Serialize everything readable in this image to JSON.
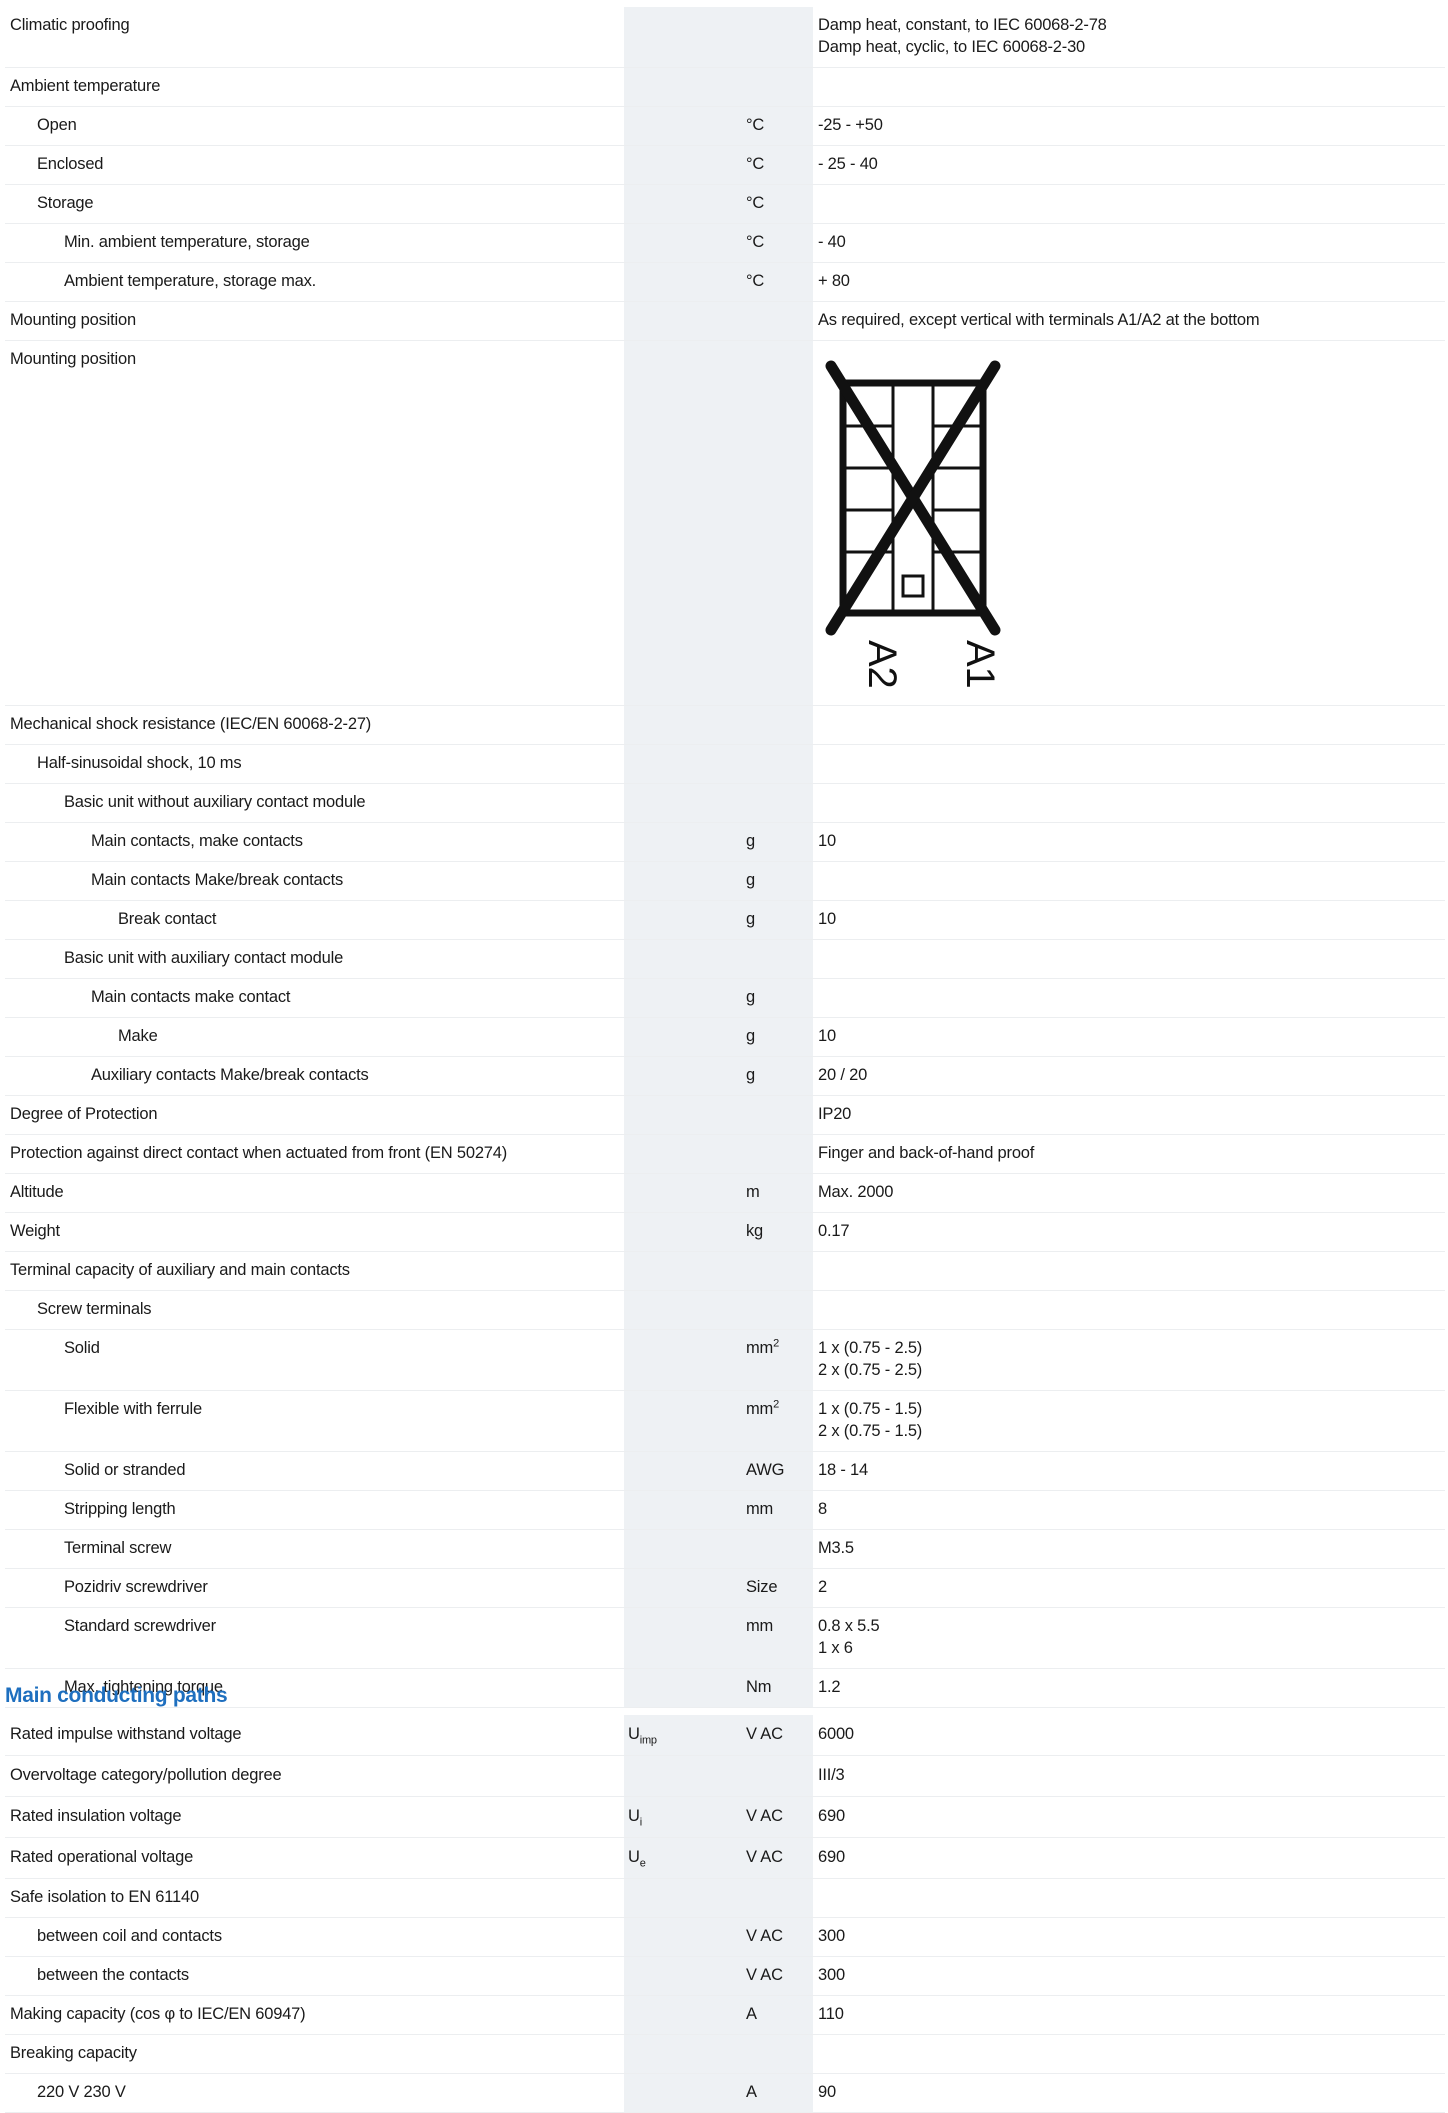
{
  "table1": [
    {
      "label": "Climatic proofing",
      "indent": 0,
      "sym": "",
      "unit": "",
      "value": "Damp heat, constant, to IEC 60068-2-78\nDamp heat, cyclic, to IEC 60068-2-30",
      "h": "r60"
    },
    {
      "label": "Ambient temperature",
      "indent": 0,
      "sym": "",
      "unit": "",
      "value": "",
      "h": "r38"
    },
    {
      "label": "Open",
      "indent": 1,
      "sym": "",
      "unit": "°C",
      "value": "-25 - +50",
      "h": "r38"
    },
    {
      "label": "Enclosed",
      "indent": 1,
      "sym": "",
      "unit": "°C",
      "value": "- 25 - 40",
      "h": "r38"
    },
    {
      "label": "Storage",
      "indent": 1,
      "sym": "",
      "unit": "°C",
      "value": "",
      "h": "r38"
    },
    {
      "label": "Min. ambient temperature, storage",
      "indent": 2,
      "sym": "",
      "unit": "°C",
      "value": "- 40",
      "h": "r38"
    },
    {
      "label": "Ambient temperature, storage max.",
      "indent": 2,
      "sym": "",
      "unit": "°C",
      "value": "+ 80",
      "h": "r38"
    },
    {
      "label": "Mounting position",
      "indent": 0,
      "sym": "",
      "unit": "",
      "value": "As required, except vertical with terminals A1/A2 at the bottom",
      "h": "r38"
    },
    {
      "label": "Mounting position",
      "indent": 0,
      "sym": "",
      "unit": "",
      "value": "",
      "h": "r365",
      "diagram": true
    },
    {
      "label": "Mechanical shock resistance (IEC/EN 60068-2-27)",
      "indent": 0,
      "sym": "",
      "unit": "",
      "value": "",
      "h": "r38"
    },
    {
      "label": "Half-sinusoidal shock, 10 ms",
      "indent": 1,
      "sym": "",
      "unit": "",
      "value": "",
      "h": "r38"
    },
    {
      "label": "Basic unit without auxiliary contact module",
      "indent": 2,
      "sym": "",
      "unit": "",
      "value": "",
      "h": "r38"
    },
    {
      "label": "Main contacts, make contacts",
      "indent": 3,
      "sym": "",
      "unit": "g",
      "value": "10",
      "h": "r38"
    },
    {
      "label": "Main contacts Make/break contacts",
      "indent": 3,
      "sym": "",
      "unit": "g",
      "value": "",
      "h": "r38"
    },
    {
      "label": "Break contact",
      "indent": 4,
      "sym": "",
      "unit": "g",
      "value": "10",
      "h": "r38"
    },
    {
      "label": "Basic unit with auxiliary contact module",
      "indent": 2,
      "sym": "",
      "unit": "",
      "value": "",
      "h": "r38"
    },
    {
      "label": "Main contacts make contact",
      "indent": 3,
      "sym": "",
      "unit": "g",
      "value": "",
      "h": "r38"
    },
    {
      "label": "Make",
      "indent": 4,
      "sym": "",
      "unit": "g",
      "value": "10",
      "h": "r38"
    },
    {
      "label": "Auxiliary contacts Make/break contacts",
      "indent": 3,
      "sym": "",
      "unit": "g",
      "value": "20 / 20",
      "h": "r38"
    },
    {
      "label": "Degree of Protection",
      "indent": 0,
      "sym": "",
      "unit": "",
      "value": "IP20",
      "h": "r38"
    },
    {
      "label": "Protection against direct contact when actuated from front (EN 50274)",
      "indent": 0,
      "sym": "",
      "unit": "",
      "value": "Finger and back-of-hand proof",
      "h": "r38"
    },
    {
      "label": "Altitude",
      "indent": 0,
      "sym": "",
      "unit": "m",
      "value": "Max. 2000",
      "h": "r38"
    },
    {
      "label": "Weight",
      "indent": 0,
      "sym": "",
      "unit": "kg",
      "value": "0.17",
      "h": "r38"
    },
    {
      "label": "Terminal capacity of auxiliary and main contacts",
      "indent": 0,
      "sym": "",
      "unit": "",
      "value": "",
      "h": "r38"
    },
    {
      "label": "Screw terminals",
      "indent": 1,
      "sym": "",
      "unit": "",
      "value": "",
      "h": "r38"
    },
    {
      "label": "Solid",
      "indent": 2,
      "sym": "",
      "unit": "mm",
      "unit_sup": "2",
      "value": "1 x (0.75 - 2.5)\n2 x (0.75 - 2.5)",
      "h": "r60"
    },
    {
      "label": "Flexible with ferrule",
      "indent": 2,
      "sym": "",
      "unit": "mm",
      "unit_sup": "2",
      "value": "1 x (0.75 - 1.5)\n2 x (0.75 - 1.5)",
      "h": "r60"
    },
    {
      "label": "Solid or stranded",
      "indent": 2,
      "sym": "",
      "unit": "AWG",
      "value": "18 - 14",
      "h": "r38"
    },
    {
      "label": "Stripping length",
      "indent": 2,
      "sym": "",
      "unit": "mm",
      "value": "8",
      "h": "r38"
    },
    {
      "label": "Terminal screw",
      "indent": 2,
      "sym": "",
      "unit": "",
      "value": "M3.5",
      "h": "r38"
    },
    {
      "label": "Pozidriv screwdriver",
      "indent": 2,
      "sym": "",
      "unit": "Size",
      "value": "2",
      "h": "r38"
    },
    {
      "label": "Standard screwdriver",
      "indent": 2,
      "sym": "",
      "unit": "mm",
      "value": "0.8 x 5.5\n1 x 6",
      "h": "r60"
    },
    {
      "label": "Max. tightening torque",
      "indent": 2,
      "sym": "",
      "unit": "Nm",
      "value": "1.2",
      "h": "r38"
    }
  ],
  "diagram": {
    "label_a1": "A1",
    "label_a2": "A2"
  },
  "section_title": "Main conducting paths",
  "table2": [
    {
      "label": "Rated impulse withstand voltage",
      "indent": 0,
      "sym": "U",
      "sym_sub": "imp",
      "unit": "V AC",
      "value": "6000",
      "h": "r41"
    },
    {
      "label": "Overvoltage category/pollution degree",
      "indent": 0,
      "sym": "",
      "unit": "",
      "value": "III/3",
      "h": "r41"
    },
    {
      "label": "Rated insulation voltage",
      "indent": 0,
      "sym": "U",
      "sym_sub": "i",
      "unit": "V AC",
      "value": "690",
      "h": "r41"
    },
    {
      "label": "Rated operational voltage",
      "indent": 0,
      "sym": "U",
      "sym_sub": "e",
      "unit": "V AC",
      "value": "690",
      "h": "r41"
    },
    {
      "label": "Safe isolation to EN 61140",
      "indent": 0,
      "sym": "",
      "unit": "",
      "value": "",
      "h": "r38"
    },
    {
      "label": "between coil and contacts",
      "indent": 1,
      "sym": "",
      "unit": "V AC",
      "value": "300",
      "h": "r38"
    },
    {
      "label": "between the contacts",
      "indent": 1,
      "sym": "",
      "unit": "V AC",
      "value": "300",
      "h": "r38"
    },
    {
      "label": "Making capacity (cos φ to IEC/EN 60947)",
      "indent": 0,
      "sym": "",
      "unit": "A",
      "value": "110",
      "h": "r38"
    },
    {
      "label": "Breaking capacity",
      "indent": 0,
      "sym": "",
      "unit": "",
      "value": "",
      "h": "r38"
    },
    {
      "label": "220 V 230 V",
      "indent": 1,
      "sym": "",
      "unit": "A",
      "value": "90",
      "h": "r38"
    }
  ]
}
